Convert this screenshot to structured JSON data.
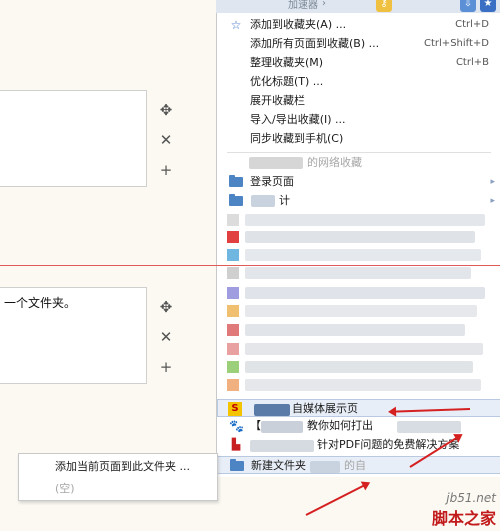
{
  "colors": {
    "accent": "#1f4e9c",
    "folder": "#4d84c4",
    "red": "#d42020",
    "menu_bg": "#ffffff",
    "editor_bg": "#fbf9f2"
  },
  "browser": {
    "title_fragment": "加速器"
  },
  "editor": {
    "card2_text": "一个文件夹。",
    "tool_icons": [
      "move-icon",
      "close-icon",
      "plus-icon"
    ]
  },
  "menu": {
    "actions": [
      {
        "label": "添加到收藏夹(A) ...",
        "shortcut": "Ctrl+D",
        "icon": "star-outline-icon"
      },
      {
        "label": "添加所有页面到收藏(B) ...",
        "shortcut": "Ctrl+Shift+D"
      },
      {
        "label": "整理收藏夹(M)",
        "shortcut": "Ctrl+B"
      },
      {
        "label": "优化标题(T) ..."
      },
      {
        "label": "展开收藏栏"
      },
      {
        "label": "导入/导出收藏(I) ..."
      },
      {
        "label": "同步收藏到手机(C)"
      }
    ],
    "section_header": "的网络收藏",
    "folders": [
      {
        "label": "登录页面",
        "icon": "folder-icon"
      },
      {
        "label": "计",
        "icon": "folder-icon"
      }
    ],
    "bookmarks": [
      {
        "label": "自媒体展示页",
        "icon": "sohu-favicon-icon"
      },
      {
        "label": "教你如何打出",
        "prefix": "【"
      },
      {
        "label": "针对PDF问题的免费解决方案"
      }
    ],
    "new_folder": {
      "label": "新建文件夹",
      "suffix": "的自"
    }
  },
  "submenu": {
    "items": [
      {
        "label": "添加当前页面到此文件夹 ..."
      },
      {
        "label": "(空)"
      }
    ]
  },
  "watermark": {
    "site": "jb51.net",
    "name": "脚本之家"
  }
}
